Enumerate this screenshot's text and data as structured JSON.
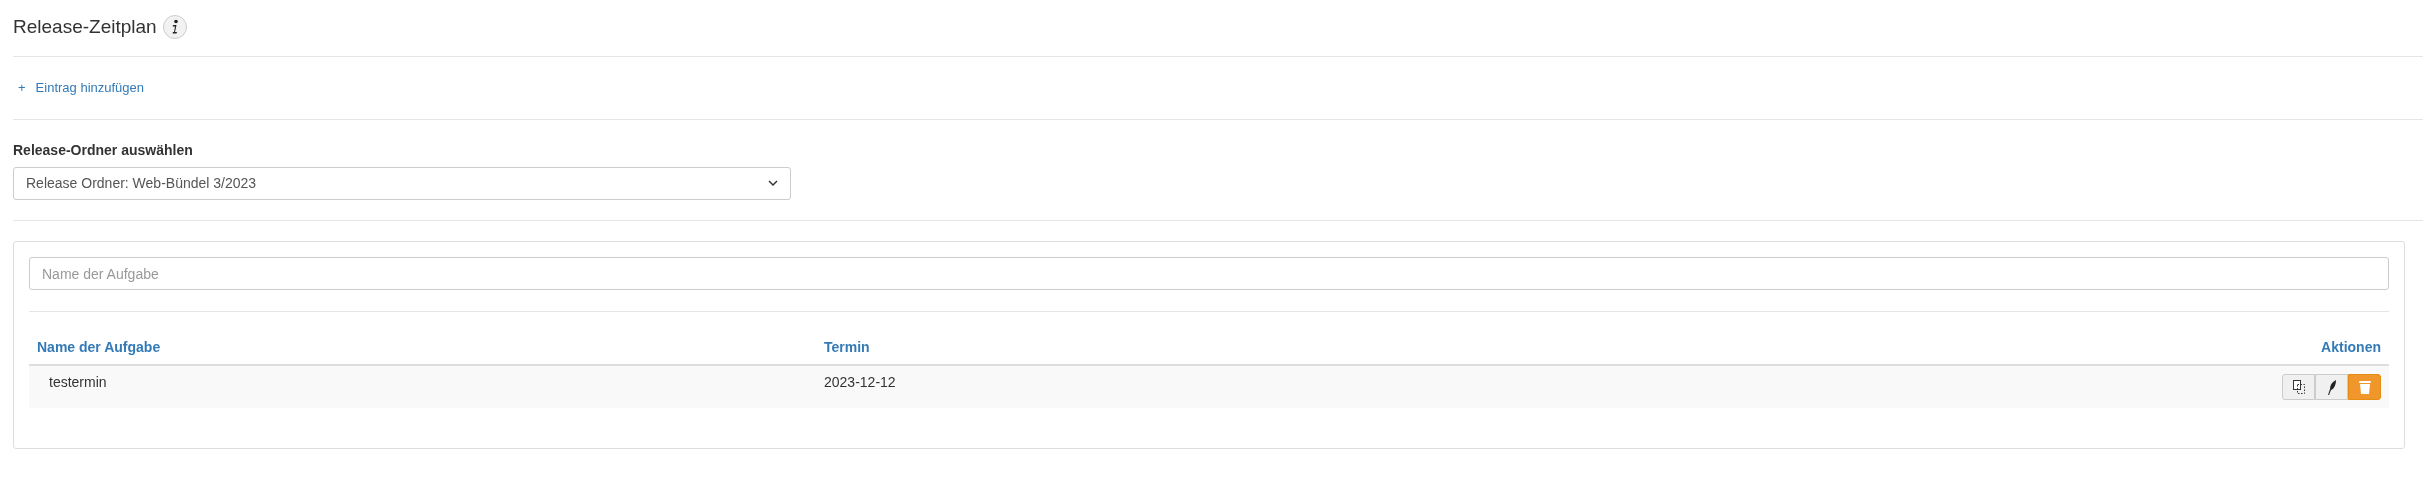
{
  "title": "Release-Zeitplan",
  "add_link": {
    "icon": "+",
    "label": "Eintrag hinzufügen"
  },
  "folder_select": {
    "label": "Release-Ordner auswählen",
    "value": "Release Ordner: Web-Bündel 3/2023"
  },
  "search": {
    "placeholder": "Name der Aufgabe"
  },
  "table": {
    "columns": [
      "Name der Aufgabe",
      "Termin",
      "Aktionen"
    ],
    "rows": [
      {
        "name": "testermin",
        "date": "2023-12-12",
        "actions": [
          {
            "kind": "copy"
          },
          {
            "kind": "edit"
          },
          {
            "kind": "delete"
          }
        ]
      }
    ]
  }
}
